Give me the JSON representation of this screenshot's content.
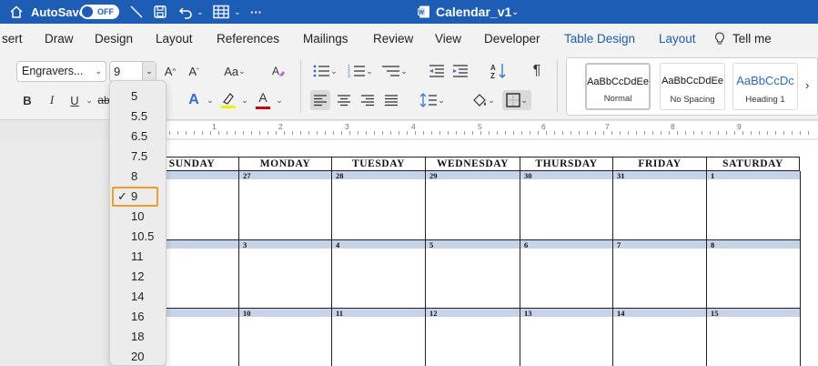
{
  "titlebar": {
    "autosave_label": "AutoSave",
    "autosave_state": "OFF",
    "document_title": "Calendar_v1",
    "more_label": "···"
  },
  "tabs": [
    {
      "label": "sert"
    },
    {
      "label": "Draw"
    },
    {
      "label": "Design"
    },
    {
      "label": "Layout"
    },
    {
      "label": "References"
    },
    {
      "label": "Mailings"
    },
    {
      "label": "Review"
    },
    {
      "label": "View"
    },
    {
      "label": "Developer"
    },
    {
      "label": "Table Design"
    },
    {
      "label": "Layout"
    },
    {
      "label": "Tell me"
    }
  ],
  "ribbon": {
    "font_name": "Engravers...",
    "font_size": "9",
    "grow_font": "A",
    "shrink_font": "A",
    "change_case": "Aa",
    "bold": "B",
    "italic": "I",
    "underline": "U",
    "strike": "ab",
    "text_effects": "A",
    "font_color": "A",
    "paragraph_mark": "¶",
    "sort": "A↓Z",
    "styles": [
      {
        "sample": "AaBbCcDdEe",
        "name": "Normal"
      },
      {
        "sample": "AaBbCcDdEe",
        "name": "No Spacing"
      },
      {
        "sample": "AaBbCcDc",
        "name": "Heading 1"
      }
    ],
    "styles_more": "›"
  },
  "ruler": {
    "numbers": [
      "1",
      "2",
      "3",
      "4",
      "5",
      "6",
      "7",
      "8",
      "9"
    ]
  },
  "calendar": {
    "days": [
      "SUNDAY",
      "MONDAY",
      "TUESDAY",
      "WEDNESDAY",
      "THURSDAY",
      "FRIDAY",
      "SATURDAY"
    ],
    "weeks": [
      [
        "",
        "27",
        "28",
        "29",
        "30",
        "31",
        "1"
      ],
      [
        "",
        "3",
        "4",
        "5",
        "6",
        "7",
        "8"
      ],
      [
        "",
        "10",
        "11",
        "12",
        "13",
        "14",
        "15"
      ]
    ]
  },
  "font_size_dropdown": {
    "options": [
      "5",
      "5.5",
      "6.5",
      "7.5",
      "8",
      "9",
      "10",
      "10.5",
      "11",
      "12",
      "14",
      "16",
      "18",
      "20"
    ],
    "selected": "9",
    "check_mark": "✓"
  },
  "colors": {
    "titlebar": "#1e5db6",
    "accent_blue": "#1e5db6",
    "highlight_orange": "#f39b2b",
    "calendar_bar": "#c7d3e8"
  }
}
